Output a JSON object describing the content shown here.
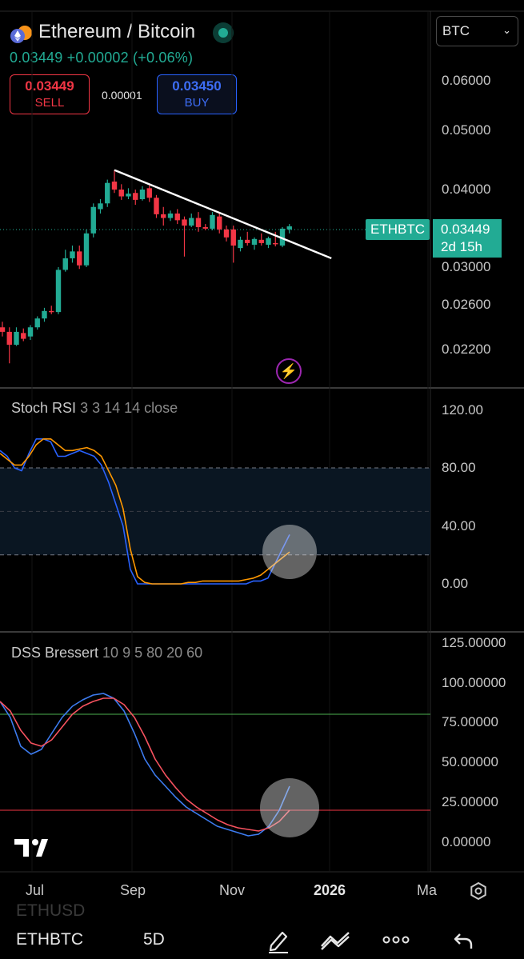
{
  "header": {
    "title": "Ethereum / Bitcoin",
    "price_change": "0.03449  +0.00002 (+0.06%)",
    "sell_price": "0.03449",
    "sell_label": "SELL",
    "buy_price": "0.03450",
    "buy_label": "BUY",
    "spread": "0.00001",
    "currency": "BTC"
  },
  "price_axis": [
    "0.06000",
    "0.05000",
    "0.04000",
    "0.03000",
    "0.02600",
    "0.02200"
  ],
  "price_tags": {
    "symbol": "ETHBTC",
    "last": "0.03449",
    "countdown": "2d 15h"
  },
  "stoch_rsi": {
    "title": "Stoch RSI",
    "params": "3 3 14 14 close",
    "axis": [
      "120.00",
      "80.00",
      "40.00",
      "0.00"
    ]
  },
  "dss": {
    "title": "DSS Bressert",
    "params": "10 9 5 80 20 60",
    "axis": [
      "125.00000",
      "100.00000",
      "75.00000",
      "50.00000",
      "25.00000",
      "0.00000"
    ]
  },
  "x_axis": [
    "Jul",
    "Sep",
    "Nov",
    "2026",
    "Ma"
  ],
  "bottom_bar": {
    "symbol": "ETHBTC",
    "interval": "5D",
    "faded_symbol": "ETHUSD"
  },
  "colors": {
    "up": "#22ab94",
    "down": "#f23645",
    "blue_line": "#2962ff",
    "orange_line": "#ff9800"
  },
  "chart_data": [
    {
      "type": "candlestick",
      "title": "Ethereum / Bitcoin",
      "interval": "5D",
      "ylim": [
        0.02,
        0.065
      ],
      "ohlc": [
        [
          0.024,
          0.0245,
          0.0232,
          0.0236
        ],
        [
          0.0236,
          0.024,
          0.021,
          0.0225
        ],
        [
          0.0225,
          0.024,
          0.0224,
          0.0236
        ],
        [
          0.0235,
          0.0239,
          0.0228,
          0.023
        ],
        [
          0.0232,
          0.0242,
          0.0229,
          0.024
        ],
        [
          0.024,
          0.025,
          0.0238,
          0.0248
        ],
        [
          0.0248,
          0.0258,
          0.0245,
          0.0255
        ],
        [
          0.0255,
          0.026,
          0.0252,
          0.0254
        ],
        [
          0.0254,
          0.03,
          0.0252,
          0.0297
        ],
        [
          0.0297,
          0.032,
          0.0295,
          0.031
        ],
        [
          0.031,
          0.0325,
          0.0305,
          0.0318
        ],
        [
          0.0318,
          0.0325,
          0.0298,
          0.0302
        ],
        [
          0.0302,
          0.0345,
          0.03,
          0.034
        ],
        [
          0.034,
          0.038,
          0.0335,
          0.0375
        ],
        [
          0.0372,
          0.0386,
          0.0366,
          0.038
        ],
        [
          0.038,
          0.0415,
          0.0375,
          0.041
        ],
        [
          0.0412,
          0.043,
          0.0395,
          0.04
        ],
        [
          0.04,
          0.0408,
          0.0385,
          0.039
        ],
        [
          0.039,
          0.0402,
          0.0386,
          0.0394
        ],
        [
          0.0395,
          0.04,
          0.0378,
          0.0385
        ],
        [
          0.0386,
          0.0405,
          0.0384,
          0.04
        ],
        [
          0.0402,
          0.0406,
          0.0382,
          0.0388
        ],
        [
          0.0388,
          0.0392,
          0.036,
          0.0365
        ],
        [
          0.0365,
          0.0375,
          0.035,
          0.036
        ],
        [
          0.036,
          0.037,
          0.0356,
          0.0366
        ],
        [
          0.0366,
          0.0372,
          0.0352,
          0.0357
        ],
        [
          0.0358,
          0.0362,
          0.0312,
          0.035
        ],
        [
          0.035,
          0.0366,
          0.0348,
          0.036
        ],
        [
          0.036,
          0.0368,
          0.0342,
          0.0348
        ],
        [
          0.0348,
          0.0352,
          0.0344,
          0.0346
        ],
        [
          0.0346,
          0.0368,
          0.0344,
          0.0364
        ],
        [
          0.0362,
          0.0366,
          0.034,
          0.0345
        ],
        [
          0.0345,
          0.035,
          0.033,
          0.0335
        ],
        [
          0.0345,
          0.035,
          0.0305,
          0.0325
        ],
        [
          0.0322,
          0.0336,
          0.0318,
          0.0332
        ],
        [
          0.0332,
          0.0342,
          0.0325,
          0.0328
        ],
        [
          0.0326,
          0.0335,
          0.032,
          0.0333
        ],
        [
          0.0332,
          0.034,
          0.0325,
          0.0328
        ],
        [
          0.0326,
          0.0336,
          0.0322,
          0.0334
        ],
        [
          0.0328,
          0.0342,
          0.0324,
          0.0327
        ],
        [
          0.0325,
          0.0348,
          0.0323,
          0.0346
        ],
        [
          0.0345,
          0.0352,
          0.034,
          0.0349
        ]
      ],
      "trendline": [
        [
          16,
          0.043
        ],
        [
          47,
          0.031
        ]
      ],
      "last_price": 0.03449
    },
    {
      "type": "line",
      "title": "Stoch RSI",
      "ylim": [
        -60,
        130
      ],
      "bands": [
        20,
        50,
        80
      ],
      "series": [
        {
          "values": [
            92,
            88,
            80,
            78,
            90,
            100,
            100,
            98,
            88,
            88,
            90,
            92,
            90,
            88,
            82,
            70,
            55,
            40,
            10,
            0,
            0,
            0,
            0,
            0,
            0,
            0,
            0,
            0,
            0,
            0,
            0,
            0,
            0,
            0,
            0,
            2,
            2,
            4,
            14,
            24,
            34
          ]
        },
        {
          "values": [
            90,
            86,
            82,
            82,
            88,
            96,
            100,
            100,
            96,
            92,
            92,
            93,
            94,
            92,
            88,
            78,
            68,
            52,
            24,
            5,
            1,
            0,
            0,
            0,
            0,
            0,
            1,
            1,
            2,
            2,
            2,
            2,
            2,
            2,
            3,
            4,
            6,
            10,
            14,
            18,
            22
          ]
        }
      ]
    },
    {
      "type": "line",
      "title": "DSS Bressert",
      "ylim": [
        -30,
        140
      ],
      "bands": [
        20,
        80
      ],
      "series": [
        {
          "values": [
            88,
            78,
            60,
            55,
            58,
            68,
            78,
            85,
            89,
            92,
            93,
            90,
            82,
            68,
            52,
            42,
            35,
            28,
            22,
            18,
            14,
            10,
            8,
            6,
            4,
            5,
            10,
            20,
            35
          ]
        },
        {
          "values": [
            88,
            82,
            70,
            62,
            60,
            64,
            72,
            80,
            85,
            88,
            90,
            90,
            86,
            78,
            66,
            52,
            42,
            34,
            27,
            22,
            18,
            14,
            11,
            9,
            8,
            7,
            9,
            13,
            20
          ]
        }
      ]
    }
  ]
}
